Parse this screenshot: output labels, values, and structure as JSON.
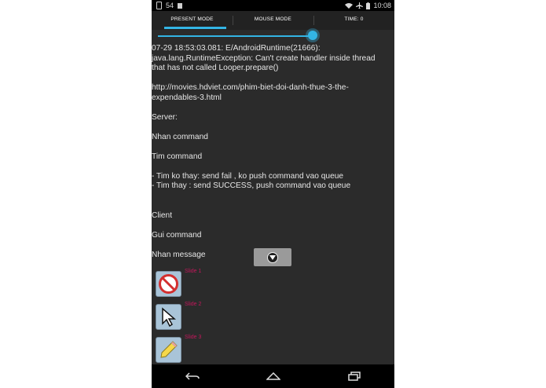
{
  "statusbar": {
    "notif_count": "54",
    "time": "10:08"
  },
  "tabs": [
    {
      "label": "PRESENT MODE",
      "selected": true
    },
    {
      "label": "MOUSE MODE",
      "selected": false
    },
    {
      "label": "TIME: 0",
      "selected": false
    }
  ],
  "slider": {
    "value": 1.0
  },
  "log": {
    "line1": "07-29 18:53:03.081: E/AndroidRuntime(21666): java.lang.RuntimeException: Can't create handler inside thread that has not called Looper.prepare()",
    "line2": "http://movies.hdviet.com/phim-biet-doi-danh-thue-3-the-expendables-3.html",
    "line3": "Server:",
    "line4": "Nhan command",
    "line5": "Tim command",
    "line6": "- Tim ko thay: send fail , ko push command vao queue",
    "line7": "- Tim thay : send SUCCESS, push command vao queue",
    "line8": "Client",
    "line9": "Gui command",
    "line10": "Nhan message"
  },
  "slides": [
    {
      "label": "Slide 1",
      "icon": "no-sign-icon"
    },
    {
      "label": "Slide 2",
      "icon": "cursor-icon"
    },
    {
      "label": "Slide 3",
      "icon": "pencil-icon"
    }
  ],
  "colors": {
    "accent": "#33b5e5",
    "slide_label": "#c2185b"
  }
}
